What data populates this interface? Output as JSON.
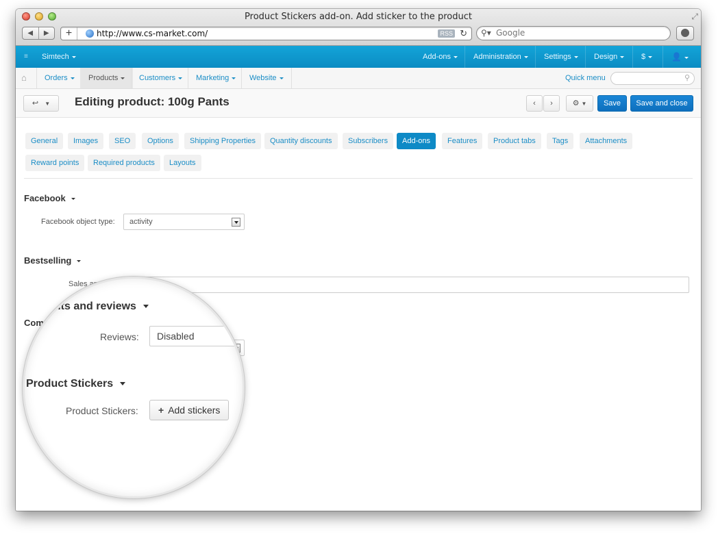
{
  "browser": {
    "window_title": "Product Stickers add-on. Add sticker to the product",
    "url": "http://www.cs-market.com/",
    "rss_badge": "RSS",
    "search_placeholder": "Google"
  },
  "topbar": {
    "brand": "Simtech",
    "menus": [
      "Add-ons",
      "Administration",
      "Settings",
      "Design",
      "$"
    ]
  },
  "navbar": {
    "items": [
      "Orders",
      "Products",
      "Customers",
      "Marketing",
      "Website"
    ],
    "active": "Products",
    "quick_menu": "Quick menu"
  },
  "page": {
    "title": "Editing product: 100g Pants",
    "save_label": "Save",
    "save_close_label": "Save and close"
  },
  "tabs": {
    "row1": [
      "General",
      "Images",
      "SEO",
      "Options",
      "Shipping Properties",
      "Quantity discounts",
      "Subscribers",
      "Add-ons",
      "Features",
      "Product tabs",
      "Tags",
      "Attachments"
    ],
    "row2": [
      "Reward points",
      "Required products",
      "Layouts"
    ],
    "active": "Add-ons"
  },
  "sections": {
    "facebook": {
      "title": "Facebook",
      "object_type_label": "Facebook object type:",
      "object_type_value": "activity"
    },
    "bestselling": {
      "title": "Bestselling",
      "sales_amount_label": "Sales amo"
    },
    "comments": {
      "title_fragment": "Com"
    }
  },
  "magnifier": {
    "comments_title_fragment": "ents and reviews",
    "reviews_label": "Reviews:",
    "reviews_value": "Disabled",
    "stickers_title": "Product Stickers",
    "stickers_label": "Product Stickers:",
    "add_stickers_label": "Add stickers"
  }
}
